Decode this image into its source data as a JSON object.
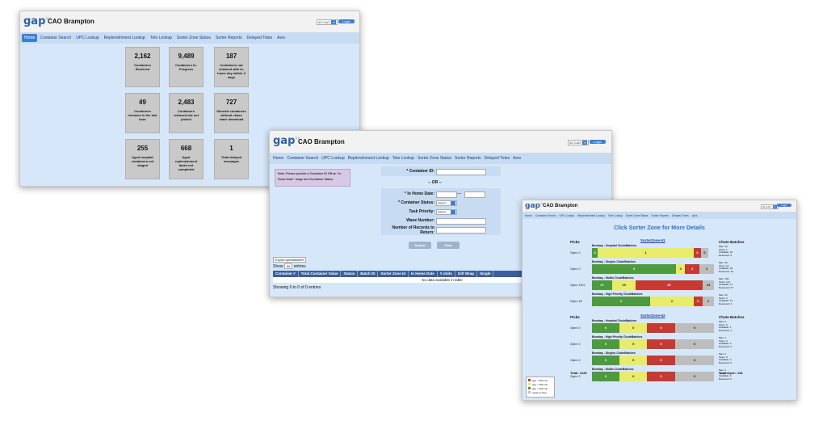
{
  "app": {
    "brand": "gap",
    "brand_sup": "inc",
    "title": "CAO Brampton",
    "location": "40 CAO",
    "login": "Login"
  },
  "nav": [
    "Home",
    "Container Search",
    "UPC Lookup",
    "Replenishment Lookup",
    "Tote Lookup",
    "Sorter Zone Status",
    "Sorter Reports",
    "Delayed Totes",
    "Asrs"
  ],
  "dashboard": {
    "tiles": [
      {
        "num": "2,162",
        "label": "Containers Received"
      },
      {
        "num": "9,489",
        "label": "Containers In-Progress"
      },
      {
        "num": "187",
        "label": "Containers not released with in-home day within 3 days"
      },
      {
        "num": "49",
        "label": "Containers released in the last hour"
      },
      {
        "num": "2,483",
        "label": "Containers released but not picked"
      },
      {
        "num": "727",
        "label": "Shorted containers without chase wave download"
      },
      {
        "num": "255",
        "label": "Aged hospital containers not staged"
      },
      {
        "num": "668",
        "label": "Aged replenishment tasks not completed"
      },
      {
        "num": "1",
        "label": "Total delayed messages"
      }
    ]
  },
  "search": {
    "note": "Note: Please provide a Container ID OR an \"In Home Date\" range and Container Status",
    "container_id": "* Container ID:",
    "or": "-- OR --",
    "in_home_date": "* In Home Date:",
    "date_sep": "—",
    "container_status": "* Container Status:",
    "task_priority": "Task Priority:",
    "wave_number": "Wave Number:",
    "records": "Number of Records to Return:",
    "select": "Select...",
    "search_btn": "Search",
    "clear_btn": "Clear",
    "export": "Export spreadsheet",
    "show": "Show",
    "show_val": "50",
    "entries": "entries",
    "columns": [
      "Container #",
      "Total Container Value",
      "Status",
      "Batch ID",
      "Sorter Zone Id",
      "In Home Date",
      "# Units",
      "Gift Wrap",
      "Single"
    ],
    "empty": "No data available in table",
    "info": "Showing 0 to 0 of 0 entries"
  },
  "sorter": {
    "title": "Click Sorter Zone for More Details",
    "picks_label": "Picks",
    "chute_label": "Chute Batches",
    "zones": [
      {
        "name": "SorterZone-51",
        "rows": [
          {
            "label": "Bombay - Hospital ChuteBatches",
            "open": "Open: 0",
            "stats": [
              "Max: 34",
              "Open: 1",
              "Available: 26",
              "Reserved: 5"
            ],
            "segs": [
              {
                "c": "g",
                "v": "0",
                "w": 4
              },
              {
                "c": "y",
                "v": "1",
                "w": 66
              },
              {
                "c": "r",
                "v": "0",
                "w": 5
              },
              {
                "c": "gr",
                "v": "0",
                "w": 5
              }
            ]
          },
          {
            "label": "Bombay - Singles ChuteBatches",
            "open": "Open: 0",
            "stats": [
              "Max: 30",
              "Open: 12",
              "Available: 15",
              "Reserved: 15"
            ],
            "segs": [
              {
                "c": "g",
                "v": "0",
                "w": 58
              },
              {
                "c": "y",
                "v": "0",
                "w": 6
              },
              {
                "c": "r",
                "v": "2",
                "w": 10
              },
              {
                "c": "gr",
                "v": "2",
                "w": 10
              }
            ]
          },
          {
            "label": "Bombay - Multis ChuteBatches",
            "open": "Open: 1201",
            "stats": [
              "Max: 169",
              "Open: 114",
              "Available: 17",
              "Reserved: 27"
            ],
            "segs": [
              {
                "c": "g",
                "v": "27",
                "w": 14
              },
              {
                "c": "y",
                "v": "19",
                "w": 16
              },
              {
                "c": "r",
                "v": "29",
                "w": 46
              },
              {
                "c": "gr",
                "v": "14",
                "w": 8
              }
            ]
          },
          {
            "label": "Bombay - High Priority ChuteBatches",
            "open": "Open: 18",
            "stats": [
              "Max: 34",
              "Open: 6",
              "Available: 13",
              "Reserved: 2"
            ],
            "segs": [
              {
                "c": "g",
                "v": "2",
                "w": 40
              },
              {
                "c": "y",
                "v": "2",
                "w": 30
              },
              {
                "c": "r",
                "v": "0",
                "w": 6
              },
              {
                "c": "gr",
                "v": "1",
                "w": 8
              }
            ]
          }
        ]
      },
      {
        "name": "SorterZone-52",
        "rows": [
          {
            "label": "Bombay - Hospital ChuteBatches",
            "open": "Open: 0",
            "stats": [
              "Max: 2",
              "Open: 0",
              "Available: 1",
              "Reserved: 1"
            ],
            "segs": [
              {
                "c": "g",
                "v": "0",
                "w": 19
              },
              {
                "c": "y",
                "v": "0",
                "w": 19
              },
              {
                "c": "r",
                "v": "0",
                "w": 19
              },
              {
                "c": "gr",
                "v": "0",
                "w": 27
              }
            ]
          },
          {
            "label": "Bombay - High Priority ChuteBatches",
            "open": "Open: 0",
            "stats": [
              "Max: 2",
              "Open: 0",
              "Available: 2",
              "Reserved: 0"
            ],
            "segs": [
              {
                "c": "g",
                "v": "0",
                "w": 19
              },
              {
                "c": "y",
                "v": "0",
                "w": 19
              },
              {
                "c": "r",
                "v": "0",
                "w": 19
              },
              {
                "c": "gr",
                "v": "0",
                "w": 27
              }
            ]
          },
          {
            "label": "Bombay - Singles ChuteBatches",
            "open": "Open: 0",
            "stats": [
              "Max: 2",
              "Open: 0",
              "Available: 2",
              "Reserved: 0"
            ],
            "segs": [
              {
                "c": "g",
                "v": "0",
                "w": 19
              },
              {
                "c": "y",
                "v": "0",
                "w": 19
              },
              {
                "c": "r",
                "v": "0",
                "w": 19
              },
              {
                "c": "gr",
                "v": "0",
                "w": 27
              }
            ]
          },
          {
            "label": "Bombay - Multis ChuteBatches",
            "open": "Open: 0",
            "stats": [
              "Max: 2",
              "Open: 0",
              "Available: 2",
              "Reserved: 0"
            ],
            "segs": [
              {
                "c": "g",
                "v": "0",
                "w": 19
              },
              {
                "c": "y",
                "v": "0",
                "w": 19
              },
              {
                "c": "r",
                "v": "0",
                "w": 19
              },
              {
                "c": "gr",
                "v": "0",
                "w": 27
              }
            ]
          }
        ]
      }
    ],
    "total_picks": "Total: 1228",
    "total_open": "Total Open: 118",
    "legend": [
      "age > 550 min",
      "age > 300 min",
      "age > 200 min",
      "ready to drop"
    ]
  }
}
